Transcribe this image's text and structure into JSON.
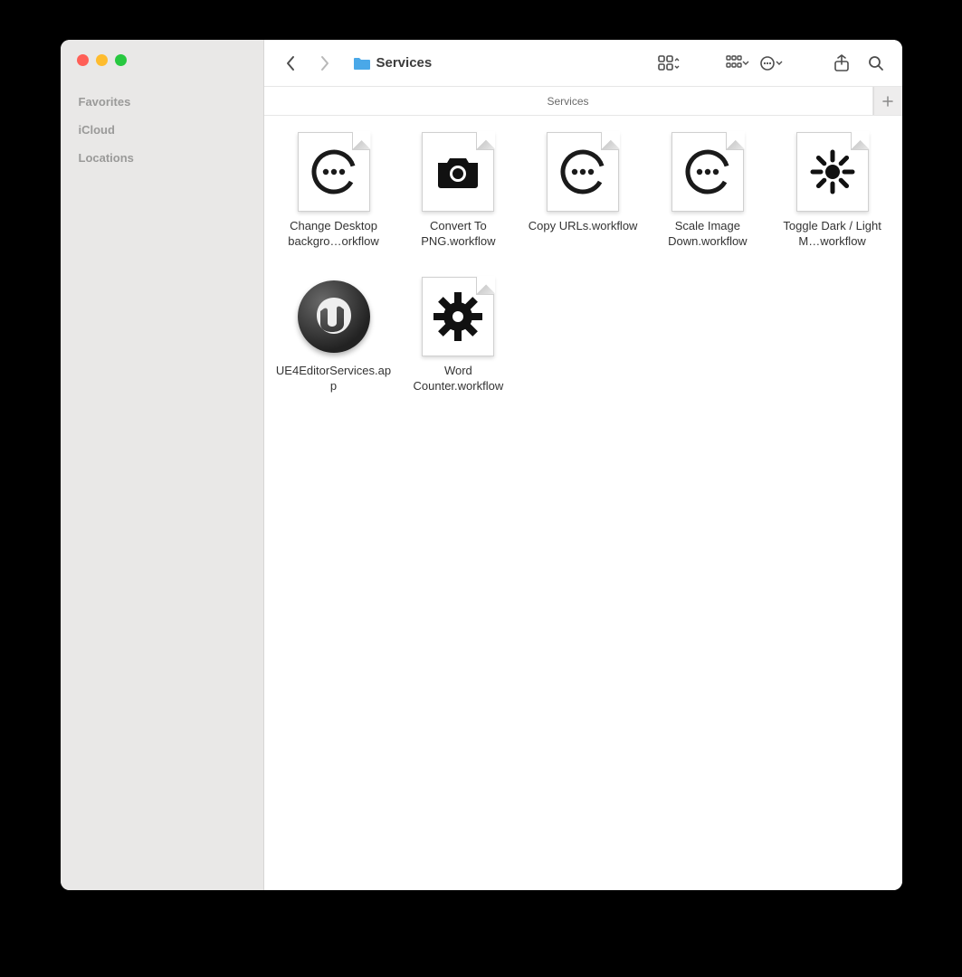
{
  "window": {
    "title": "Services",
    "tab_title": "Services"
  },
  "sidebar": {
    "sections": [
      {
        "label": "Favorites"
      },
      {
        "label": "iCloud"
      },
      {
        "label": "Locations"
      }
    ]
  },
  "files": [
    {
      "name": "Change Desktop backgro…orkflow",
      "icon": "dots"
    },
    {
      "name": "Convert To PNG.workflow",
      "icon": "camera"
    },
    {
      "name": "Copy URLs.workflow",
      "icon": "dots"
    },
    {
      "name": "Scale Image Down.workflow",
      "icon": "dots"
    },
    {
      "name": "Toggle Dark / Light M…workflow",
      "icon": "sun"
    },
    {
      "name": "UE4EditorServices.app",
      "icon": "ue4"
    },
    {
      "name": "Word Counter.workflow",
      "icon": "gear"
    }
  ]
}
